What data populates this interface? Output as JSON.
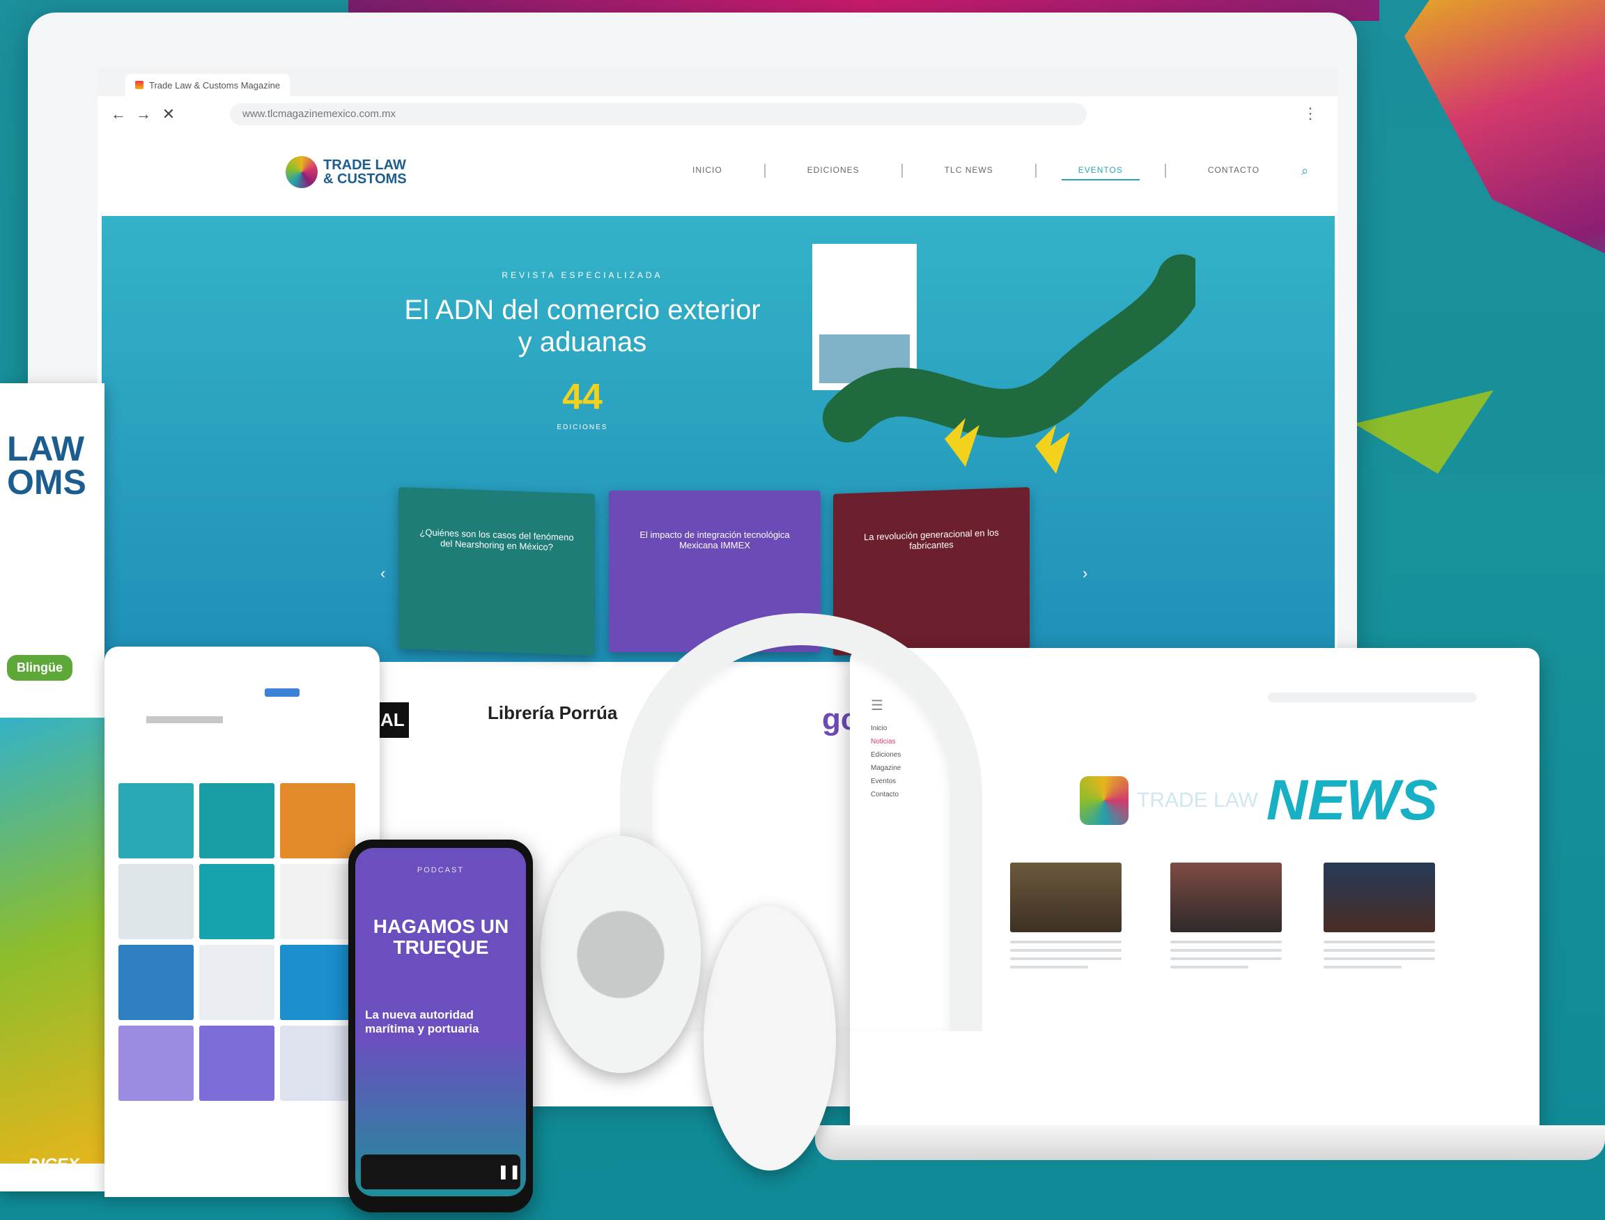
{
  "browser": {
    "tab_title": "Trade Law & Customs Magazine",
    "url": "www.tlcmagazinemexico.com.mx"
  },
  "site": {
    "logo_line1": "TRADE LAW",
    "logo_line2": "& CUSTOMS",
    "nav": [
      "INICIO",
      "EDICIONES",
      "TLC NEWS",
      "EVENTOS",
      "CONTACTO"
    ],
    "active_nav": "EVENTOS"
  },
  "hero": {
    "kicker": "REVISTA ESPECIALIZADA",
    "title": "El ADN del comercio exterior y aduanas",
    "number": "44",
    "number_label": "EDICIONES"
  },
  "cards": [
    {
      "text": "¿Quiénes son los casos del fenómeno del Nearshoring en México?"
    },
    {
      "text": "El impacto de integración tecnológica Mexicana IMMEX"
    },
    {
      "text": "La revolución generacional en los fabricantes"
    }
  ],
  "tablet": {
    "logo_line1": "LAW",
    "logo_line2": "OMS",
    "brand": "DICEX",
    "badge": "Blingüe"
  },
  "phone": {
    "label": "PODCAST",
    "title": "HAGAMOS UN TRUEQUE",
    "subtitle": "La nueva autoridad marítima y portuaria"
  },
  "partners": [
    "AL",
    "Librería Porrúa",
    "gc"
  ],
  "news": {
    "pre": "TRADE LAW",
    "word": "NEWS",
    "sidebar": [
      "Inicio",
      "Noticias",
      "Ediciones",
      "Magazine",
      "Eventos",
      "Contacto"
    ]
  },
  "colors": {
    "teal": "#26a6b8",
    "purple": "#6c4bb6",
    "magenta": "#d33a6b",
    "gold": "#f2d21d"
  }
}
